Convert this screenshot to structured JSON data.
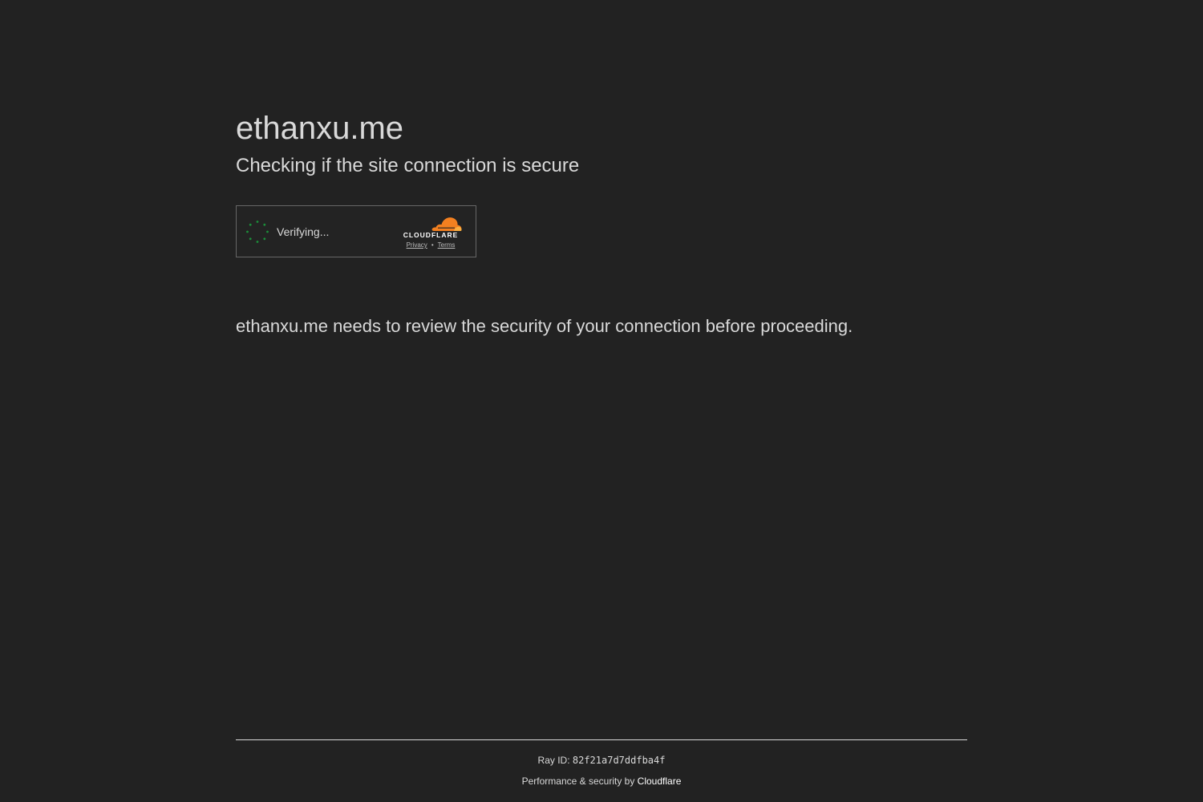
{
  "page": {
    "site_title": "ethanxu.me",
    "subtitle": "Checking if the site connection is secure",
    "message": "ethanxu.me needs to review the security of your connection before proceeding."
  },
  "widget": {
    "status_text": "Verifying...",
    "spinner_icon": "loading-spinner-icon",
    "spinner_color": "#1b8f3a",
    "brand_icon": "cloudflare-cloud-icon",
    "brand_color": "#f38020",
    "brand_wordmark": "CLOUDFLARE",
    "privacy_label": "Privacy",
    "separator": "•",
    "terms_label": "Terms"
  },
  "footer": {
    "ray_label": "Ray ID: ",
    "ray_id": "82f21a7d7ddfba4f",
    "perf_prefix": "Performance & security by ",
    "perf_link": "Cloudflare"
  },
  "colors": {
    "background": "#222222",
    "text": "#d9d9d9"
  }
}
